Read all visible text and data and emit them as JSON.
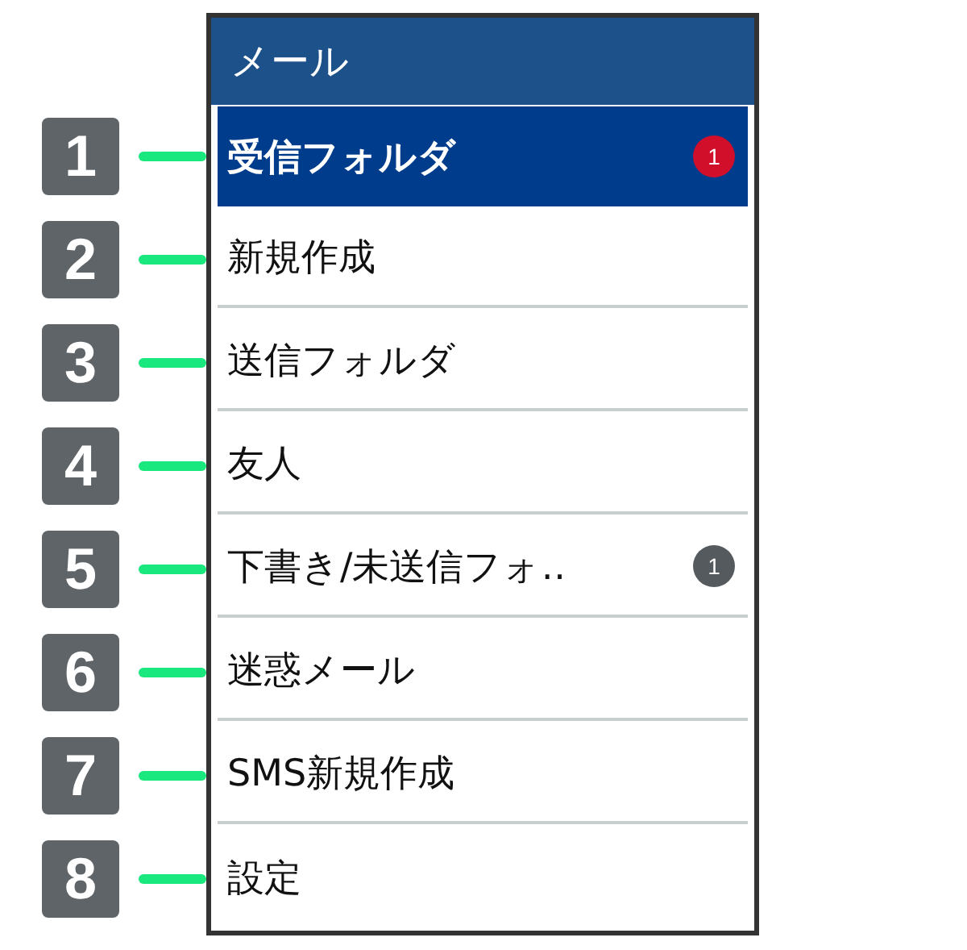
{
  "header": {
    "title": "メール"
  },
  "menu": [
    {
      "callout": "1",
      "label": "受信フォルダ",
      "selected": true,
      "badge": {
        "text": "1",
        "kind": "unread"
      }
    },
    {
      "callout": "2",
      "label": "新規作成",
      "selected": false
    },
    {
      "callout": "3",
      "label": "送信フォルダ",
      "selected": false
    },
    {
      "callout": "4",
      "label": "友人",
      "selected": false
    },
    {
      "callout": "5",
      "label": "下書き/未送信フォ‥",
      "selected": false,
      "badge": {
        "text": "1",
        "kind": "draft"
      }
    },
    {
      "callout": "6",
      "label": "迷惑メール",
      "selected": false
    },
    {
      "callout": "7",
      "label": "SMS新規作成",
      "selected": false
    },
    {
      "callout": "8",
      "label": "設定",
      "selected": false
    }
  ]
}
